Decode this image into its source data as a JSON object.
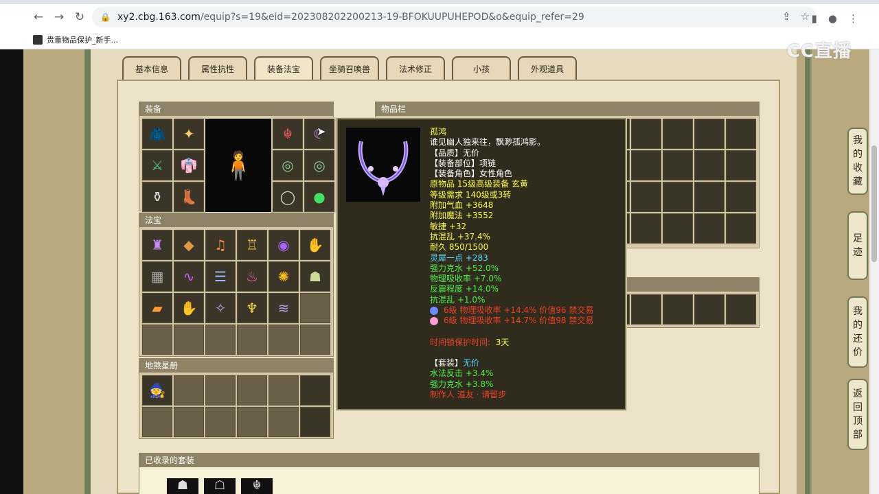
{
  "browser": {
    "url_host": "xy2.cbg.163.com",
    "url_path": "/equip?s=19&eid=202308202200213-19-BFOKUUPUHEPOD&o&equip_refer=29",
    "bookmark_label": "贵重物品保护_新手..."
  },
  "watermark": "CC直播",
  "tabs": [
    "基本信息",
    "属性抗性",
    "装备法宝",
    "坐骑召唤兽",
    "法术修正",
    "小孩",
    "外观道具"
  ],
  "sections": {
    "equipment": "装备",
    "fabao": "法宝",
    "dishazxingce": "地煞星册",
    "items": "物品栏",
    "collected_sets": "已收录的套装"
  },
  "tooltip": {
    "name": "孤鸿",
    "desc": "谁见幽人独来往，飘渺孤鸿影。",
    "quality": "【品质】无价",
    "slot": "【装备部位】项链",
    "role": "【装备角色】女性角色",
    "source": "原物品 15级高级装备 玄黄",
    "level_req": "等级需求 140级或3转",
    "hp": "附加气血 +3648",
    "mp": "附加魔法 +3552",
    "agility": "敏捷 +32",
    "anti_chaos": "抗混乱 +37.4%",
    "durability": "耐久 850/1500",
    "spirit": "灵犀一点 +283",
    "water_pierce": "强力克水 +52.0%",
    "phys_absorb": "物理吸收率 +7.0%",
    "counter": "反震程度 +14.0%",
    "anti_chaos2": "抗混乱 +1.0%",
    "gem1": "6级 物理吸收率 +14.4% 价值96 禁交易",
    "gem2": "6级 物理吸收率 +14.7% 价值98 禁交易",
    "protect_label": "时间锁保护时间:",
    "protect_value": "3天",
    "set_label": "【套装】",
    "set_value": "无价",
    "set1": "水法反击 +3.4%",
    "set2": "强力克水 +3.8%",
    "maker": "制作人 道友 · 请留步"
  },
  "side_buttons": [
    "我的收藏",
    "足迹",
    "我的还价",
    "返回顶部"
  ]
}
